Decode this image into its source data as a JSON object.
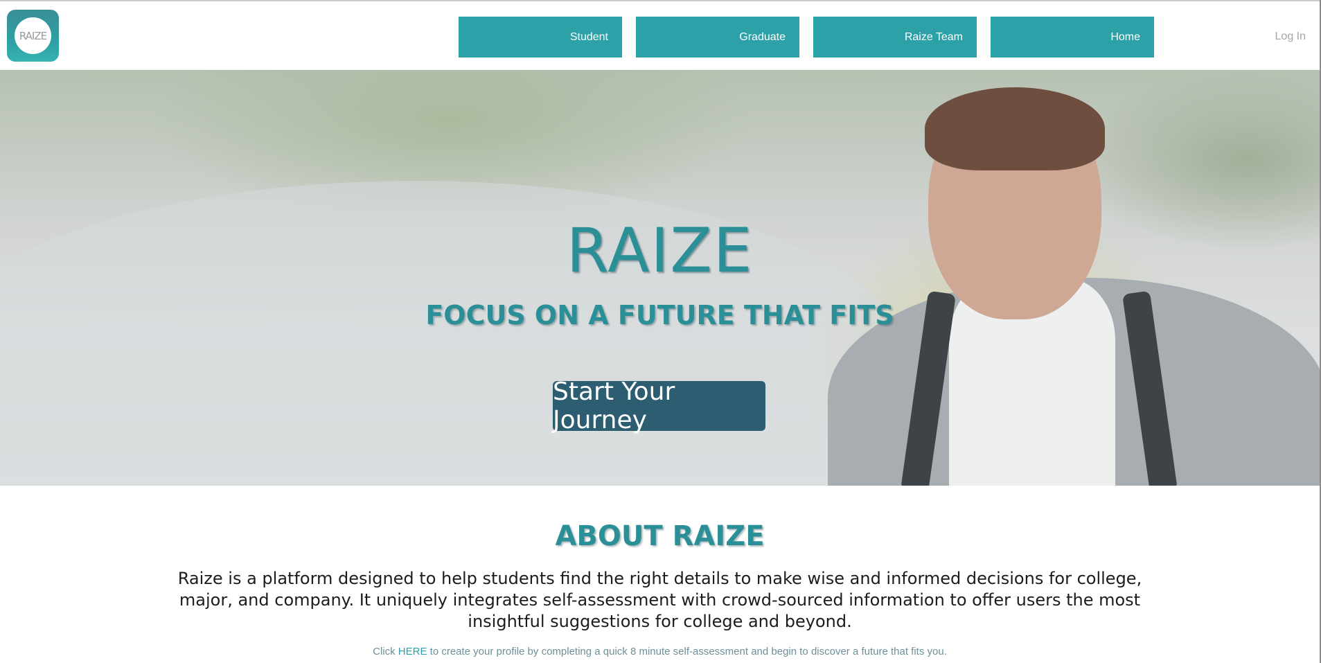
{
  "brand": {
    "logo_text": "RAIZE"
  },
  "nav": {
    "items": [
      {
        "label": "Student"
      },
      {
        "label": "Graduate"
      },
      {
        "label": "Raize Team"
      },
      {
        "label": "Home"
      }
    ],
    "login": "Log In"
  },
  "hero": {
    "title": "RAIZE",
    "subtitle": "FOCUS ON A FUTURE THAT FITS",
    "cta_label": "Start Your Journey"
  },
  "about": {
    "title": "ABOUT RAIZE",
    "body": "Raize is a platform designed to help students find the right details to make wise and informed decisions for college, major, and company. It uniquely integrates self-assessment with crowd-sourced information to offer users the most insightful suggestions for college and beyond.",
    "note_prefix": "Click ",
    "note_link": "HERE",
    "note_suffix": " to create your profile by completing a quick 8 minute self-assessment and begin to discover a future that fits you."
  },
  "colors": {
    "accent": "#2da1a8",
    "cta": "#2d5d70",
    "heading": "#2a8f96"
  }
}
